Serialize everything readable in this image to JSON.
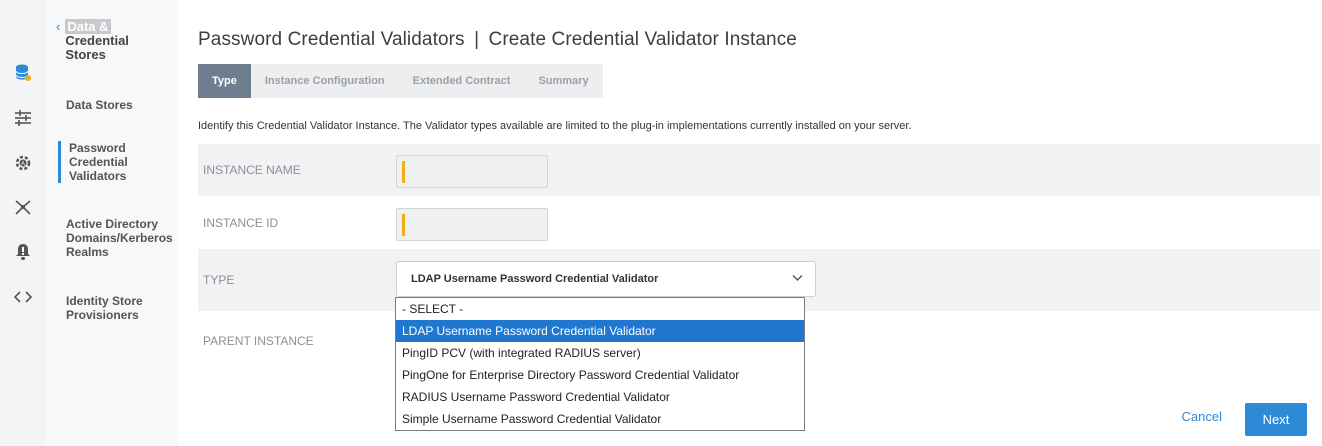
{
  "rail": {
    "icons": [
      "database-icon",
      "sliders-icon",
      "gear-shield-icon",
      "network-icon",
      "bell-icon",
      "code-icon"
    ]
  },
  "subnav": {
    "back_highlight": "Data &",
    "back_rest": "Credential Stores",
    "items": [
      {
        "label": "Data Stores"
      },
      {
        "label": "Password Credential Validators",
        "active": true
      },
      {
        "label": "Active Directory Domains/Kerberos Realms"
      },
      {
        "label": "Identity Store Provisioners"
      }
    ]
  },
  "page": {
    "title_left": "Password Credential Validators",
    "title_sep": "|",
    "title_right": "Create Credential Validator Instance",
    "tabs": [
      "Type",
      "Instance Configuration",
      "Extended Contract",
      "Summary"
    ],
    "description": "Identify this Credential Validator Instance. The Validator types available are limited to the plug-in implementations currently installed on your server."
  },
  "form": {
    "instance_name_label": "INSTANCE NAME",
    "instance_name_value": "",
    "instance_id_label": "INSTANCE ID",
    "instance_id_value": "",
    "type_label": "TYPE",
    "type_value": "LDAP Username Password Credential Validator",
    "parent_label": "PARENT INSTANCE"
  },
  "dropdown": {
    "options": [
      "- SELECT -",
      "LDAP Username Password Credential Validator",
      "PingID PCV (with integrated RADIUS server)",
      "PingOne for Enterprise Directory Password Credential Validator",
      "RADIUS Username Password Credential Validator",
      "Simple Username Password Credential Validator"
    ],
    "selected_index": 1
  },
  "actions": {
    "cancel": "Cancel",
    "next": "Next"
  },
  "colors": {
    "accent": "#2d8ad6",
    "tab_active": "#6e7e8e",
    "required_bar": "#f0ad1c",
    "option_selected": "#1f77d0"
  }
}
